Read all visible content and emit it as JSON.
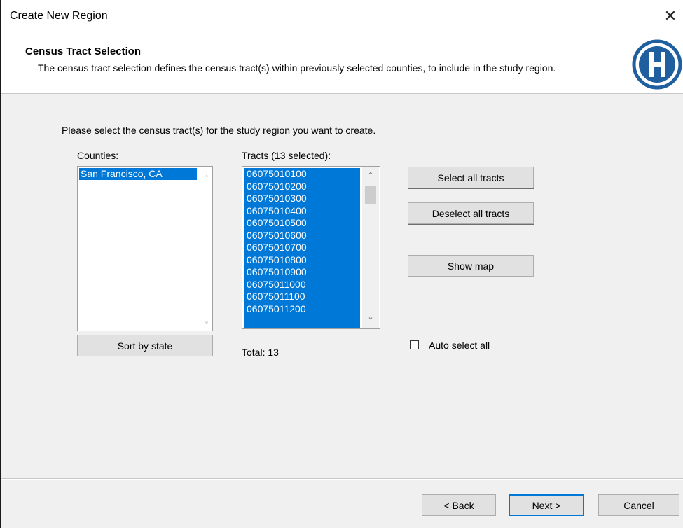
{
  "window": {
    "title": "Create New Region",
    "close_glyph": "✕"
  },
  "header": {
    "title": "Census Tract Selection",
    "description": "The census tract selection defines the census tract(s) within previously selected counties, to include in the study region.",
    "logo_letter": "H",
    "logo_icon": "hazus-logo-icon"
  },
  "instruction": "Please select the census tract(s) for the study region you want to create.",
  "counties": {
    "label": "Counties:",
    "items": [
      "San Francisco, CA"
    ],
    "selected": "San Francisco, CA",
    "sort_button": "Sort by state"
  },
  "tracts": {
    "label": "Tracts (13 selected):",
    "items": [
      "06075010100",
      "06075010200",
      "06075010300",
      "06075010400",
      "06075010500",
      "06075010600",
      "06075010700",
      "06075010800",
      "06075010900",
      "06075011000",
      "06075011100",
      "06075011200"
    ],
    "total": "Total: 13"
  },
  "actions": {
    "select_all": "Select all tracts",
    "deselect_all": "Deselect all tracts",
    "show_map": "Show map",
    "auto_select_label": "Auto select all",
    "auto_select_checked": false
  },
  "footer": {
    "back": "< Back",
    "next": "Next >",
    "cancel": "Cancel"
  },
  "colors": {
    "selection": "#0078d7",
    "logo_blue": "#1f5fa0"
  }
}
